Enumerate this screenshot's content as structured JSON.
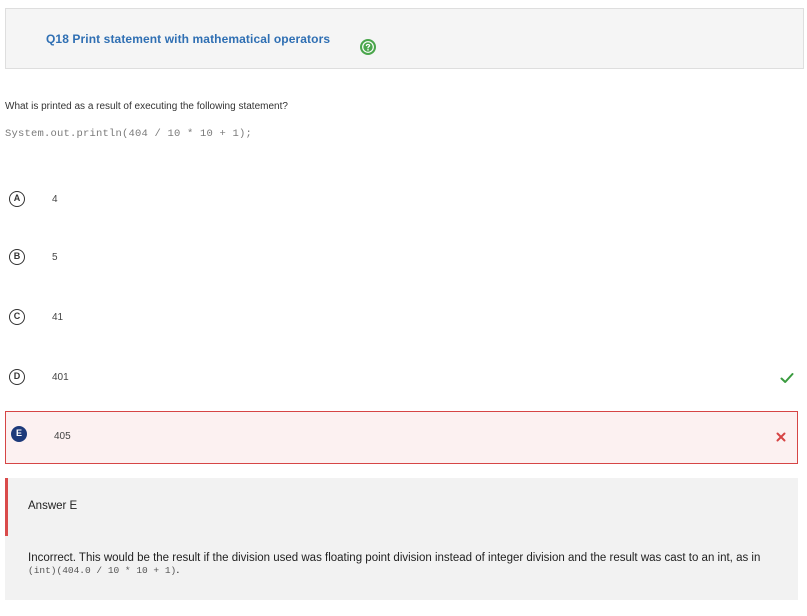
{
  "header": {
    "title": "Q18 Print statement with mathematical operators",
    "help_icon": "help-icon"
  },
  "question": {
    "prompt": "What is printed as a result of executing the following statement?",
    "code": "System.out.println(404 / 10 * 10 + 1);"
  },
  "options": [
    {
      "letter": "A",
      "text": "4"
    },
    {
      "letter": "B",
      "text": "5"
    },
    {
      "letter": "C",
      "text": "41"
    },
    {
      "letter": "D",
      "text": "401",
      "status_icon": "check-icon"
    },
    {
      "letter": "E",
      "text": "405",
      "status_icon": "close-icon"
    }
  ],
  "feedback": {
    "title": "Answer E",
    "text_before_code": "Incorrect. This would be the result if the division used was floating point division instead of integer division and the result was cast to an int, as in ",
    "code": "(int)(404.0 / 10 * 10 + 1)",
    "text_after_code": "."
  },
  "colors": {
    "title_link": "#2f6fb3",
    "help_icon": "#4aa64c",
    "correct_check": "#3a9b3f",
    "incorrect_accent": "#d64545",
    "selected_letter": "#1d3a7a"
  }
}
